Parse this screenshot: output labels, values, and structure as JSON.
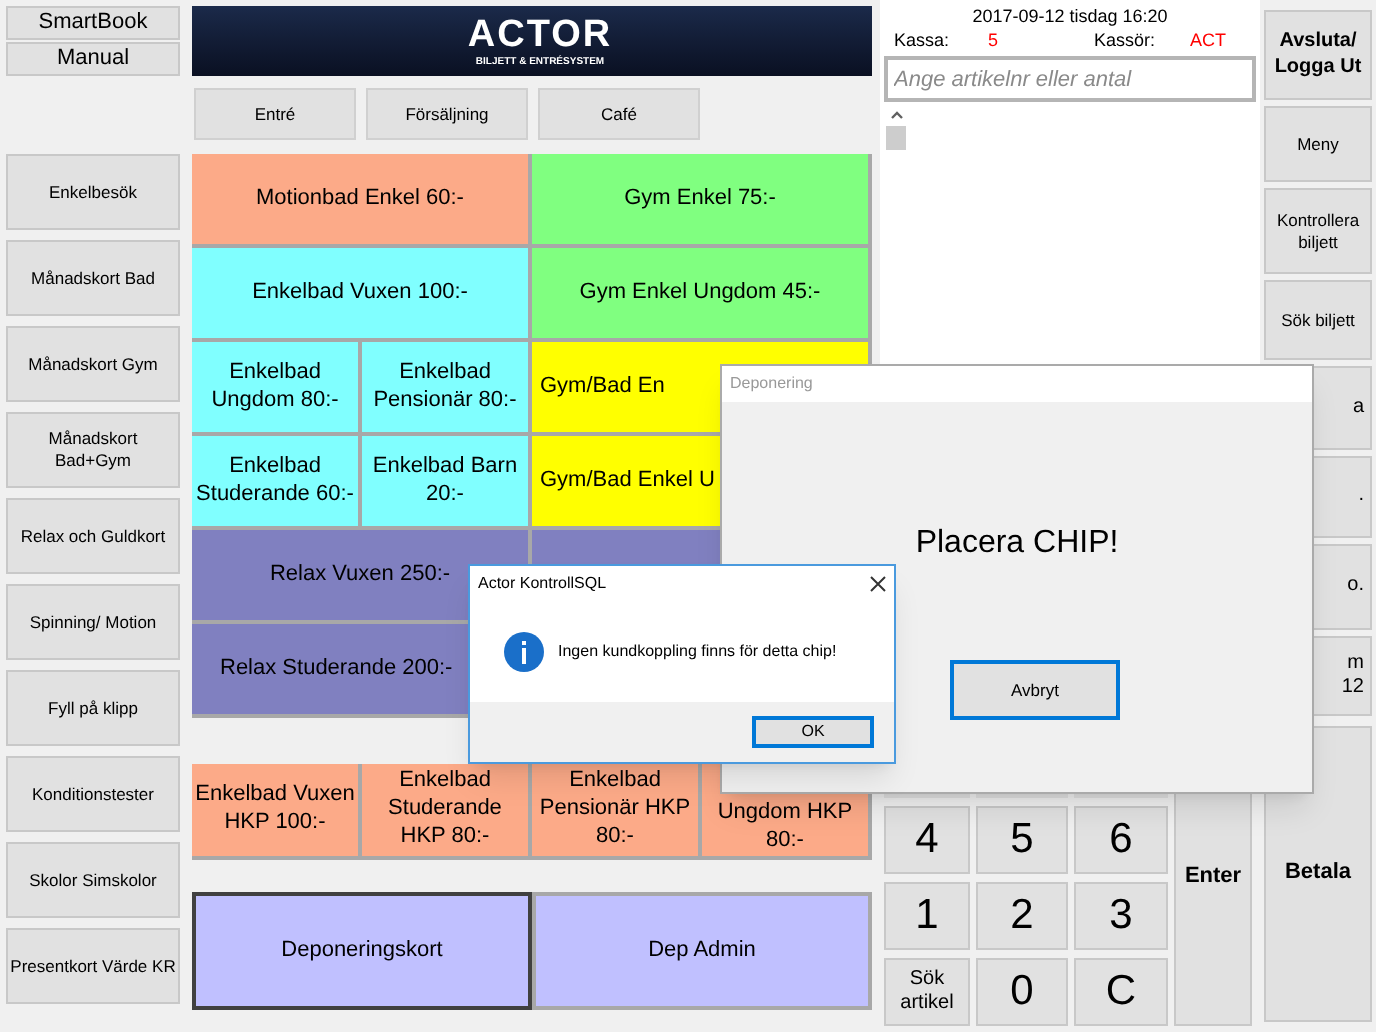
{
  "top_buttons": [
    {
      "label": "SmartBook"
    },
    {
      "label": "Manual"
    }
  ],
  "categories": [
    {
      "label": "Enkelbesök"
    },
    {
      "label": "Månadskort Bad"
    },
    {
      "label": "Månadskort Gym"
    },
    {
      "label": "Månadskort Bad+Gym"
    },
    {
      "label": "Relax och Guldkort"
    },
    {
      "label": "Spinning/ Motion"
    },
    {
      "label": "Fyll på klipp"
    },
    {
      "label": "Konditionstester"
    },
    {
      "label": "Skolor Simskolor"
    },
    {
      "label": "Presentkort Värde KR"
    }
  ],
  "logo": {
    "name": "ACTOR",
    "tagline": "BILJETT & ENTRÉSYSTEM"
  },
  "tabs": [
    {
      "label": "Entré",
      "selected": false
    },
    {
      "label": "Försäljning",
      "selected": false
    },
    {
      "label": "Café",
      "selected": false
    }
  ],
  "product_rows": [
    {
      "left": [
        {
          "kind": "full",
          "label": "Motionbad Enkel 60:-",
          "color": "#fcaa88"
        }
      ],
      "right": [
        {
          "kind": "full",
          "label": "Gym Enkel 75:-",
          "color": "#80ff80"
        }
      ]
    },
    {
      "left": [
        {
          "kind": "full",
          "label": "Enkelbad Vuxen 100:-",
          "color": "#80ffff"
        }
      ],
      "right": [
        {
          "kind": "full",
          "label": "Gym Enkel Ungdom 45:-",
          "color": "#80ff80"
        }
      ]
    },
    {
      "left": [
        {
          "kind": "full",
          "label": "Enkelbad Ungdom 80:-",
          "color": "#80ffff"
        },
        {
          "kind": "full",
          "label": "Enkelbad Pensionär 80:-",
          "color": "#80ffff"
        }
      ],
      "right": [
        {
          "kind": "partial",
          "label": "Gym/Bad En",
          "color": "#ffff00"
        }
      ]
    },
    {
      "left": [
        {
          "kind": "full",
          "label": "Enkelbad Studerande 60:-",
          "color": "#80ffff"
        },
        {
          "kind": "full",
          "label": "Enkelbad Barn 20:-",
          "color": "#80ffff"
        }
      ],
      "right": [
        {
          "kind": "partial",
          "label": "Gym/Bad Enkel U",
          "color": "#ffff00"
        }
      ]
    },
    {
      "left": [
        {
          "kind": "full",
          "label": "Relax Vuxen 250:-",
          "color": "#8080c0"
        }
      ],
      "right": [
        {
          "kind": "hidden",
          "color": "#8080c0"
        }
      ]
    },
    {
      "left": [
        {
          "kind": "left",
          "label": "Relax Studerande 200:-",
          "color": "#8080c0"
        }
      ]
    }
  ],
  "hkp_row": [
    {
      "kind": "full",
      "label": "Enkelbad Vuxen HKP 100:-",
      "color": "#fcaa88"
    },
    {
      "kind": "full",
      "label": "Enkelbad Studerande HKP 80:-",
      "color": "#fcaa88"
    },
    {
      "kind": "full",
      "label": "Enkelbad Pensionär HKP 80:-",
      "color": "#fcaa88"
    },
    {
      "kind": "partial",
      "label": "Ungdom HKP 80:-",
      "color": "#fcaa88"
    }
  ],
  "deposit_row": [
    {
      "label": "Deponeringskort",
      "selected": true
    },
    {
      "label": "Dep Admin",
      "selected": false
    }
  ],
  "status": {
    "datetime": "2017-09-12 tisdag 16:20",
    "register_label": "Kassa:",
    "register": "5",
    "cashier_label": "Kassör:",
    "cashier": "ACT"
  },
  "article_field": {
    "placeholder": "Ange artikelnr eller antal"
  },
  "right_buttons": [
    {
      "kind": "bold",
      "label": "Avsluta/ Logga Ut"
    },
    {
      "kind": "normal",
      "label": "Meny"
    },
    {
      "kind": "normal",
      "label": "Kontrollera biljett"
    },
    {
      "kind": "normal",
      "label": "Sök biljett"
    },
    {
      "kind": "partial",
      "label": "a"
    },
    {
      "kind": "partial",
      "label": "."
    },
    {
      "kind": "partial",
      "label": "o."
    },
    {
      "kind": "partial",
      "label": "m 12"
    }
  ],
  "keypad": [
    {
      "kind": "digit",
      "label": "4"
    },
    {
      "kind": "digit",
      "label": "5"
    },
    {
      "kind": "digit",
      "label": "6"
    },
    {
      "kind": "digit",
      "label": "1"
    },
    {
      "kind": "digit",
      "label": "2"
    },
    {
      "kind": "digit",
      "label": "3"
    },
    {
      "kind": "text",
      "label": "Sök artikel"
    },
    {
      "kind": "digit",
      "label": "0"
    },
    {
      "kind": "digit",
      "label": "C"
    }
  ],
  "enter_button": {
    "label": "Enter"
  },
  "pay_button": {
    "label": "Betala"
  },
  "deposit_dialog": {
    "title": "Deponering",
    "message": "Placera CHIP!",
    "button": "Avbryt"
  },
  "sql_dialog": {
    "title": "Actor KontrollSQL",
    "message": "Ingen kundkoppling finns för detta chip!",
    "button": "OK"
  }
}
